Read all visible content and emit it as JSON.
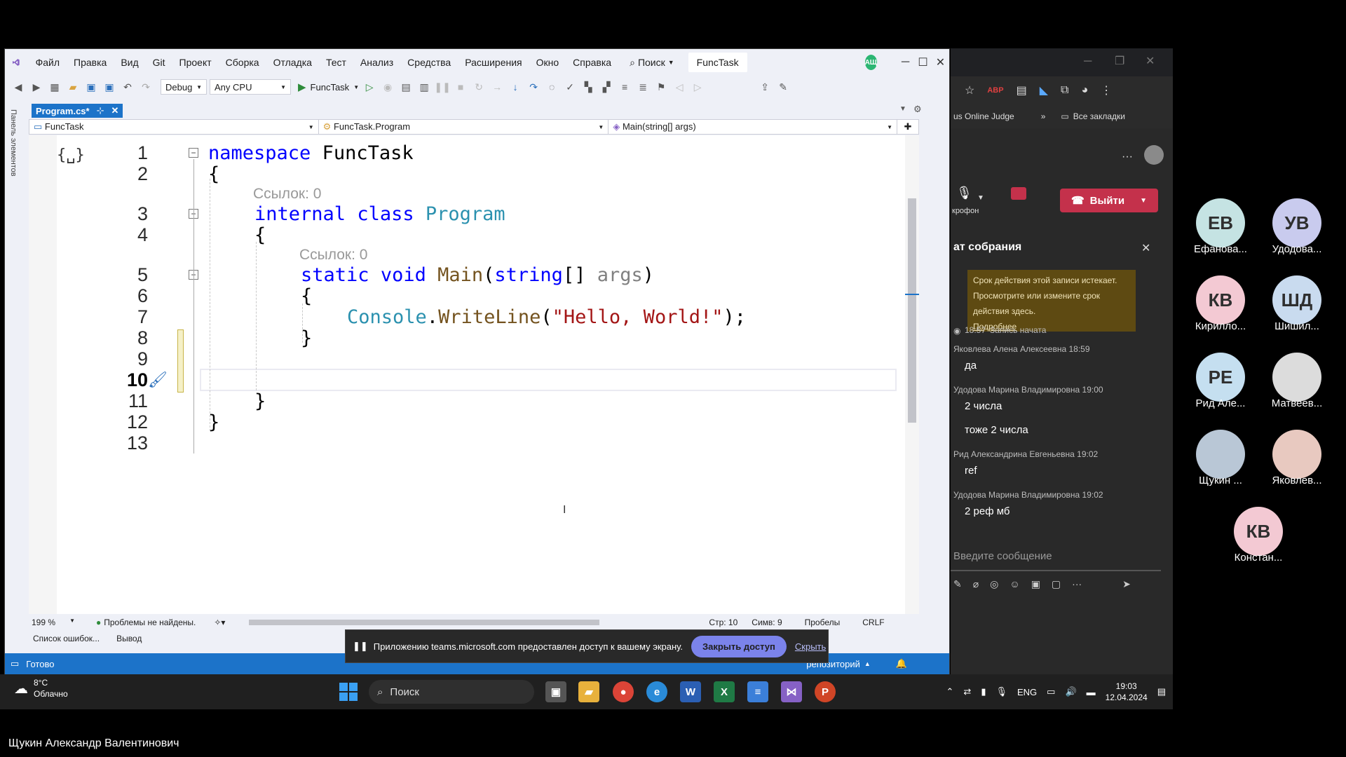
{
  "vs": {
    "menu": [
      "Файл",
      "Правка",
      "Вид",
      "Git",
      "Проект",
      "Сборка",
      "Отладка",
      "Тест",
      "Анализ",
      "Средства",
      "Расширения",
      "Окно",
      "Справка"
    ],
    "search_label": "Поиск",
    "project_name": "FuncTask",
    "live_share_initials": "АЩ",
    "toolbar": {
      "config": "Debug",
      "platform": "Any CPU",
      "run_target": "FuncTask"
    },
    "left_panel_label": "Панель элементов",
    "doc_tab": "Program.cs*",
    "nav": {
      "project": "FuncTask",
      "class": "FuncTask.Program",
      "member": "Main(string[] args)"
    },
    "code": {
      "line_numbers": [
        "1",
        "2",
        "3",
        "4",
        "5",
        "6",
        "7",
        "8",
        "9",
        "10",
        "11",
        "12",
        "13"
      ],
      "lens_ref": "Ссылок: 0",
      "namespace_kw": "namespace",
      "namespace_name": "FuncTask",
      "internal_kw": "internal",
      "class_kw": "class",
      "class_name": "Program",
      "static_kw": "static",
      "void_kw": "void",
      "main_name": "Main",
      "string_kw": "string",
      "args_name": "args",
      "console": "Console",
      "writeline": "WriteLine",
      "hello": "\"Hello, World!\""
    },
    "status": {
      "zoom": "199 %",
      "problems": "Проблемы не найдены.",
      "line": "Стр: 10",
      "col": "Симв: 9",
      "spaces": "Пробелы",
      "eol": "CRLF"
    },
    "tool_tabs": [
      "Список ошибок...",
      "Вывод"
    ],
    "statusbar": {
      "ready": "Готово",
      "repo": "репозиторий"
    }
  },
  "share_bar": {
    "message": "Приложению teams.microsoft.com предоставлен доступ к вашему экрану.",
    "stop": "Закрыть доступ",
    "hide": "Скрыть"
  },
  "taskbar": {
    "weather_temp": "8°C",
    "weather_desc": "Облачно",
    "search": "Поиск",
    "lang": "ENG",
    "time": "19:03",
    "date": "12.04.2024"
  },
  "browser": {
    "bookmark": "us Online Judge",
    "all_bookmarks": "Все закладки"
  },
  "teams": {
    "mic_label": "крофон",
    "leave": "Выйти",
    "chat_title": "ат собрания",
    "notice": "Срок действия этой записи истекает. Просмотрите или измените срок действия здесь.",
    "notice_link": "Подробнее",
    "record_time": "18:57",
    "record_text": "Запись начата",
    "messages": [
      {
        "meta": "Яковлева Алена Алексеевна  18:59",
        "text": "да"
      },
      {
        "meta": "Удодова Марина Владимировна  19:00",
        "text": "2 числа"
      },
      {
        "meta": "",
        "text": "тоже 2 числа"
      },
      {
        "meta": "Рид Александрина Евгеньевна  19:02",
        "text": "ref"
      },
      {
        "meta": "Удодова Марина Владимировна  19:02",
        "text": "2 реф мб"
      }
    ],
    "input_placeholder": "Введите сообщение"
  },
  "participants": [
    {
      "initials": "ЕВ",
      "name": "Ефанова...",
      "color": "#c5e3e3"
    },
    {
      "initials": "УВ",
      "name": "Удодова...",
      "color": "#c9cbee"
    },
    {
      "initials": "КВ",
      "name": "Кирилло...",
      "color": "#f3c9d3"
    },
    {
      "initials": "ШД",
      "name": "Шишил...",
      "color": "#c9dbef"
    },
    {
      "initials": "РЕ",
      "name": "Рид Але...",
      "color": "#c5dff0"
    },
    {
      "initials": "",
      "name": "Матвеев...",
      "color": "#dcdcdc"
    },
    {
      "initials": "",
      "name": "Щукин ...",
      "color": "#b9c7d6"
    },
    {
      "initials": "",
      "name": "Яковлев...",
      "color": "#e8c9c0"
    },
    {
      "initials": "КВ",
      "name": "Констан...",
      "color": "#f3c9d3"
    }
  ],
  "presenter_name": "Щукин Александр Валентинович"
}
